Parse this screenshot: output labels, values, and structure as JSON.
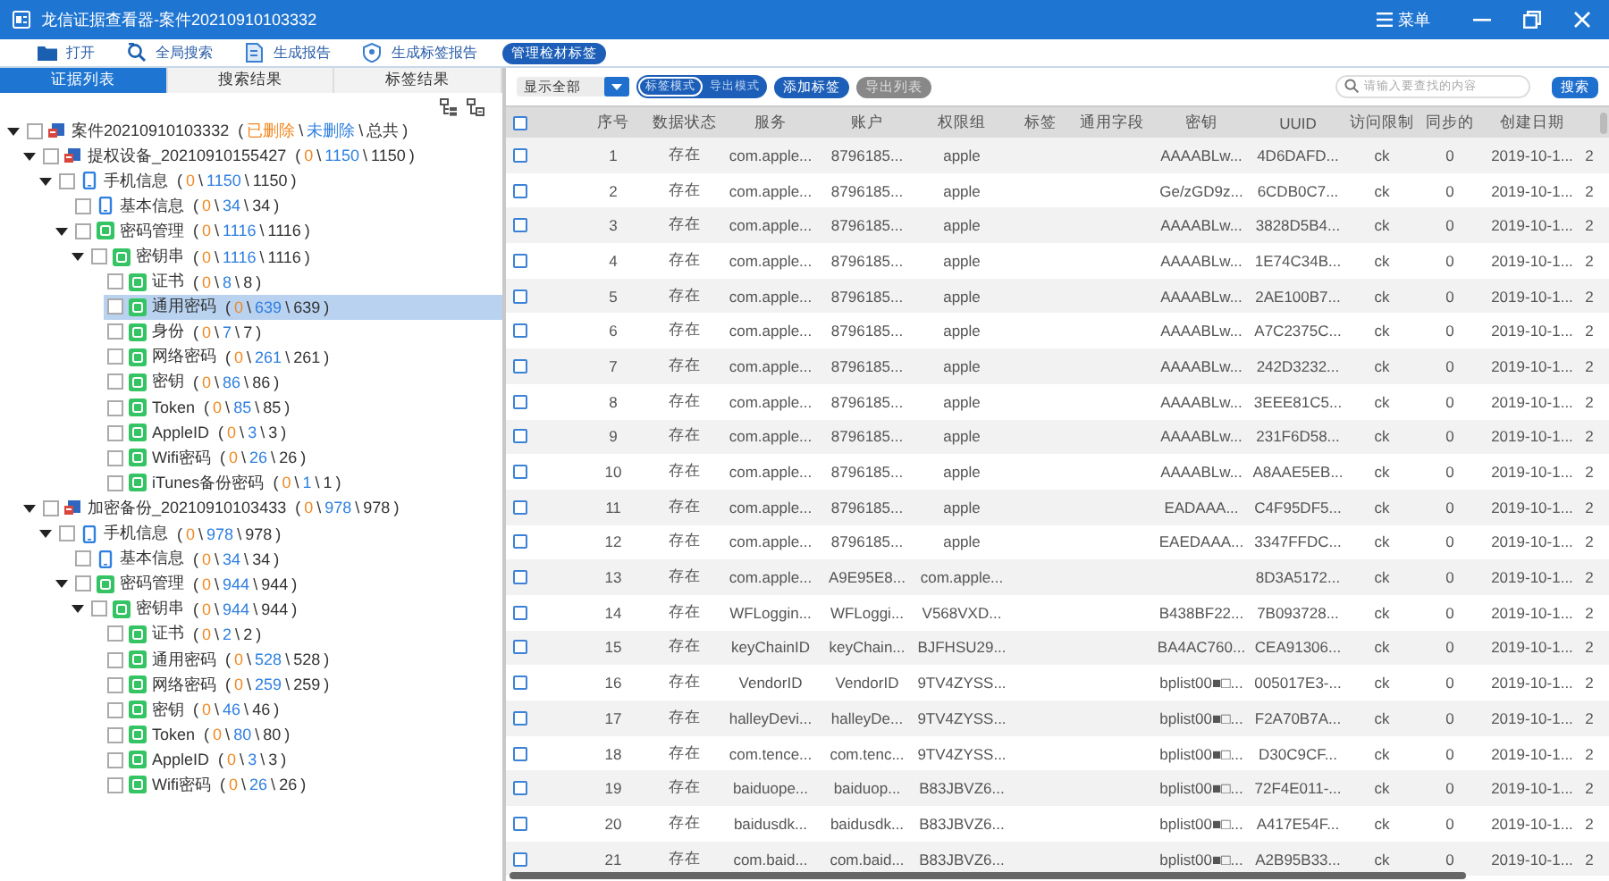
{
  "window": {
    "title": "龙信证据查看器-案件20210910103332",
    "menu": "菜单"
  },
  "toolbar": [
    {
      "label": "打开",
      "kind": "folder"
    },
    {
      "label": "全局搜索",
      "kind": "search"
    },
    {
      "label": "生成报告",
      "kind": "report"
    },
    {
      "label": "生成标签报告",
      "kind": "tag"
    }
  ],
  "manage_button": "管理检材标签",
  "left_tabs": [
    {
      "label": "证据列表",
      "selected": true
    },
    {
      "label": "搜索结果",
      "selected": false
    },
    {
      "label": "标签结果",
      "selected": false
    }
  ],
  "tree": [
    {
      "label": "案件20210910103332",
      "kind": "case",
      "counts": [
        "(",
        "已删除",
        "\\",
        "未删除",
        "\\",
        "总共",
        ")"
      ],
      "checked": false,
      "expanded": true,
      "selected": false,
      "children": [
        {
          "label": "提权设备_20210910155427",
          "kind": "case",
          "counts": [
            "(",
            "0",
            "\\",
            "1150",
            "\\",
            "1150",
            ")"
          ],
          "checked": false,
          "expanded": true,
          "selected": false,
          "children": [
            {
              "label": "手机信息",
              "kind": "phone",
              "counts": [
                "(",
                "0",
                "\\",
                "1150",
                "\\",
                "1150",
                ")"
              ],
              "checked": false,
              "expanded": true,
              "selected": false,
              "children": [
                {
                  "label": "基本信息",
                  "kind": "phone",
                  "counts": [
                    "(",
                    "0",
                    "\\",
                    "34",
                    "\\",
                    "34",
                    ")"
                  ],
                  "checked": false,
                  "selected": false
                },
                {
                  "label": "密码管理",
                  "kind": "category",
                  "counts": [
                    "(",
                    "0",
                    "\\",
                    "1116",
                    "\\",
                    "1116",
                    ")"
                  ],
                  "checked": false,
                  "expanded": true,
                  "selected": false,
                  "children": [
                    {
                      "label": "密钥串",
                      "kind": "category",
                      "counts": [
                        "(",
                        "0",
                        "\\",
                        "1116",
                        "\\",
                        "1116",
                        ")"
                      ],
                      "checked": false,
                      "expanded": true,
                      "selected": false,
                      "children": [
                        {
                          "label": "证书",
                          "kind": "category",
                          "counts": [
                            "(",
                            "0",
                            "\\",
                            "8",
                            "\\",
                            "8",
                            ")"
                          ],
                          "checked": false,
                          "selected": false
                        },
                        {
                          "label": "通用密码",
                          "kind": "category",
                          "counts": [
                            "(",
                            "0",
                            "\\",
                            "639",
                            "\\",
                            "639",
                            ")"
                          ],
                          "checked": false,
                          "selected": true
                        },
                        {
                          "label": "身份",
                          "kind": "category",
                          "counts": [
                            "(",
                            "0",
                            "\\",
                            "7",
                            "\\",
                            "7",
                            ")"
                          ],
                          "checked": false,
                          "selected": false
                        },
                        {
                          "label": "网络密码",
                          "kind": "category",
                          "counts": [
                            "(",
                            "0",
                            "\\",
                            "261",
                            "\\",
                            "261",
                            ")"
                          ],
                          "checked": false,
                          "selected": false
                        },
                        {
                          "label": "密钥",
                          "kind": "category",
                          "counts": [
                            "(",
                            "0",
                            "\\",
                            "86",
                            "\\",
                            "86",
                            ")"
                          ],
                          "checked": false,
                          "selected": false
                        },
                        {
                          "label": "Token",
                          "kind": "category",
                          "counts": [
                            "(",
                            "0",
                            "\\",
                            "85",
                            "\\",
                            "85",
                            ")"
                          ],
                          "checked": false,
                          "selected": false
                        },
                        {
                          "label": "AppleID",
                          "kind": "category",
                          "counts": [
                            "(",
                            "0",
                            "\\",
                            "3",
                            "\\",
                            "3",
                            ")"
                          ],
                          "checked": false,
                          "selected": false
                        },
                        {
                          "label": "Wifi密码",
                          "kind": "category",
                          "counts": [
                            "(",
                            "0",
                            "\\",
                            "26",
                            "\\",
                            "26",
                            ")"
                          ],
                          "checked": false,
                          "selected": false
                        },
                        {
                          "label": "iTunes备份密码",
                          "kind": "category",
                          "counts": [
                            "(",
                            "0",
                            "\\",
                            "1",
                            "\\",
                            "1",
                            ")"
                          ],
                          "checked": false,
                          "selected": false
                        }
                      ]
                    }
                  ]
                }
              ]
            }
          ]
        },
        {
          "label": "加密备份_20210910103433",
          "kind": "case",
          "counts": [
            "(",
            "0",
            "\\",
            "978",
            "\\",
            "978",
            ")"
          ],
          "checked": false,
          "expanded": true,
          "selected": false,
          "children": [
            {
              "label": "手机信息",
              "kind": "phone",
              "counts": [
                "(",
                "0",
                "\\",
                "978",
                "\\",
                "978",
                ")"
              ],
              "checked": false,
              "expanded": true,
              "selected": false,
              "children": [
                {
                  "label": "基本信息",
                  "kind": "phone",
                  "counts": [
                    "(",
                    "0",
                    "\\",
                    "34",
                    "\\",
                    "34",
                    ")"
                  ],
                  "checked": false,
                  "selected": false
                },
                {
                  "label": "密码管理",
                  "kind": "category",
                  "counts": [
                    "(",
                    "0",
                    "\\",
                    "944",
                    "\\",
                    "944",
                    ")"
                  ],
                  "checked": false,
                  "expanded": true,
                  "selected": false,
                  "children": [
                    {
                      "label": "密钥串",
                      "kind": "category",
                      "counts": [
                        "(",
                        "0",
                        "\\",
                        "944",
                        "\\",
                        "944",
                        ")"
                      ],
                      "checked": false,
                      "expanded": true,
                      "selected": false,
                      "children": [
                        {
                          "label": "证书",
                          "kind": "category",
                          "counts": [
                            "(",
                            "0",
                            "\\",
                            "2",
                            "\\",
                            "2",
                            ")"
                          ],
                          "checked": false,
                          "selected": false
                        },
                        {
                          "label": "通用密码",
                          "kind": "category",
                          "counts": [
                            "(",
                            "0",
                            "\\",
                            "528",
                            "\\",
                            "528",
                            ")"
                          ],
                          "checked": false,
                          "selected": false
                        },
                        {
                          "label": "网络密码",
                          "kind": "category",
                          "counts": [
                            "(",
                            "0",
                            "\\",
                            "259",
                            "\\",
                            "259",
                            ")"
                          ],
                          "checked": false,
                          "selected": false
                        },
                        {
                          "label": "密钥",
                          "kind": "category",
                          "counts": [
                            "(",
                            "0",
                            "\\",
                            "46",
                            "\\",
                            "46",
                            ")"
                          ],
                          "checked": false,
                          "selected": false
                        },
                        {
                          "label": "Token",
                          "kind": "category",
                          "counts": [
                            "(",
                            "0",
                            "\\",
                            "80",
                            "\\",
                            "80",
                            ")"
                          ],
                          "checked": false,
                          "selected": false
                        },
                        {
                          "label": "AppleID",
                          "kind": "category",
                          "counts": [
                            "(",
                            "0",
                            "\\",
                            "3",
                            "\\",
                            "3",
                            ")"
                          ],
                          "checked": false,
                          "selected": false
                        },
                        {
                          "label": "Wifi密码",
                          "kind": "category",
                          "counts": [
                            "(",
                            "0",
                            "\\",
                            "26",
                            "\\",
                            "26",
                            ")"
                          ],
                          "checked": false,
                          "selected": false
                        }
                      ]
                    }
                  ]
                }
              ]
            }
          ]
        }
      ]
    }
  ],
  "filter": {
    "value": "显示全部"
  },
  "mode_toggle": [
    {
      "label": "标签模式",
      "selected": true
    },
    {
      "label": "导出模式",
      "selected": false
    }
  ],
  "actions": [
    {
      "label": "添加标签",
      "disabled": false
    },
    {
      "label": "导出列表",
      "disabled": true
    }
  ],
  "search": {
    "placeholder": "请输入要查找的内容",
    "button": "搜索"
  },
  "table": {
    "header_checked": false,
    "columns": [
      "序号",
      "数据状态",
      "服务",
      "账户",
      "权限组",
      "标签",
      "通用字段",
      "密钥",
      "UUID",
      "访问限制",
      "同步的",
      "创建日期"
    ],
    "rows": [
      {
        "checked": false,
        "cells": [
          "1",
          "存在",
          "com.apple...",
          "8796185...",
          "apple",
          null,
          null,
          "AAAABLw...",
          "4D6DAFD...",
          "ck",
          "0",
          "2019-10-1...",
          "2"
        ]
      },
      {
        "checked": false,
        "cells": [
          "2",
          "存在",
          "com.apple...",
          "8796185...",
          "apple",
          null,
          null,
          "Ge/zGD9z...",
          "6CDB0C7...",
          "ck",
          "0",
          "2019-10-1...",
          "2"
        ]
      },
      {
        "checked": false,
        "cells": [
          "3",
          "存在",
          "com.apple...",
          "8796185...",
          "apple",
          null,
          null,
          "AAAABLw...",
          "3828D5B4...",
          "ck",
          "0",
          "2019-10-1...",
          "2"
        ]
      },
      {
        "checked": false,
        "cells": [
          "4",
          "存在",
          "com.apple...",
          "8796185...",
          "apple",
          null,
          null,
          "AAAABLw...",
          "1E74C34B...",
          "ck",
          "0",
          "2019-10-1...",
          "2"
        ]
      },
      {
        "checked": false,
        "cells": [
          "5",
          "存在",
          "com.apple...",
          "8796185...",
          "apple",
          null,
          null,
          "AAAABLw...",
          "2AE100B7...",
          "ck",
          "0",
          "2019-10-1...",
          "2"
        ]
      },
      {
        "checked": false,
        "cells": [
          "6",
          "存在",
          "com.apple...",
          "8796185...",
          "apple",
          null,
          null,
          "AAAABLw...",
          "A7C2375C...",
          "ck",
          "0",
          "2019-10-1...",
          "2"
        ]
      },
      {
        "checked": false,
        "cells": [
          "7",
          "存在",
          "com.apple...",
          "8796185...",
          "apple",
          null,
          null,
          "AAAABLw...",
          "242D3232...",
          "ck",
          "0",
          "2019-10-1...",
          "2"
        ]
      },
      {
        "checked": false,
        "cells": [
          "8",
          "存在",
          "com.apple...",
          "8796185...",
          "apple",
          null,
          null,
          "AAAABLw...",
          "3EEE81C5...",
          "ck",
          "0",
          "2019-10-1...",
          "2"
        ]
      },
      {
        "checked": false,
        "cells": [
          "9",
          "存在",
          "com.apple...",
          "8796185...",
          "apple",
          null,
          null,
          "AAAABLw...",
          "231F6D58...",
          "ck",
          "0",
          "2019-10-1...",
          "2"
        ]
      },
      {
        "checked": false,
        "cells": [
          "10",
          "存在",
          "com.apple...",
          "8796185...",
          "apple",
          null,
          null,
          "AAAABLw...",
          "A8AAE5EB...",
          "ck",
          "0",
          "2019-10-1...",
          "2"
        ]
      },
      {
        "checked": false,
        "cells": [
          "11",
          "存在",
          "com.apple...",
          "8796185...",
          "apple",
          null,
          null,
          "EADAAA...",
          "C4F95DF5...",
          "ck",
          "0",
          "2019-10-1...",
          "2"
        ]
      },
      {
        "checked": false,
        "cells": [
          "12",
          "存在",
          "com.apple...",
          "8796185...",
          "apple",
          null,
          null,
          "EAEDAAA...",
          "3347FFDC...",
          "ck",
          "0",
          "2019-10-1...",
          "2"
        ]
      },
      {
        "checked": false,
        "cells": [
          "13",
          "存在",
          "com.apple...",
          "A9E95E8...",
          "com.apple...",
          null,
          null,
          null,
          "8D3A5172...",
          "ck",
          "0",
          "2019-10-1...",
          "2"
        ]
      },
      {
        "checked": false,
        "cells": [
          "14",
          "存在",
          "WFLoggin...",
          "WFLoggi...",
          "V568VXD...",
          null,
          null,
          "B438BF22...",
          "7B093728...",
          "ck",
          "0",
          "2019-10-1...",
          "2"
        ]
      },
      {
        "checked": false,
        "cells": [
          "15",
          "存在",
          "keyChainID",
          "keyChain...",
          "BJFHSU29...",
          null,
          null,
          "BA4AC760...",
          "CEA91306...",
          "ck",
          "0",
          "2019-10-1...",
          "2"
        ]
      },
      {
        "checked": false,
        "cells": [
          "16",
          "存在",
          "VendorID",
          "VendorID",
          "9TV4ZYSS...",
          null,
          null,
          "bplist00■□...",
          "005017E3-...",
          "ck",
          "0",
          "2019-10-1...",
          "2"
        ]
      },
      {
        "checked": false,
        "cells": [
          "17",
          "存在",
          "halleyDevi...",
          "halleyDe...",
          "9TV4ZYSS...",
          null,
          null,
          "bplist00■□...",
          "F2A70B7A...",
          "ck",
          "0",
          "2019-10-1...",
          "2"
        ]
      },
      {
        "checked": false,
        "cells": [
          "18",
          "存在",
          "com.tence...",
          "com.tenc...",
          "9TV4ZYSS...",
          null,
          null,
          "bplist00■□...",
          "D30C9CF...",
          "ck",
          "0",
          "2019-10-1...",
          "2"
        ]
      },
      {
        "checked": false,
        "cells": [
          "19",
          "存在",
          "baiduope...",
          "baiduop...",
          "B83JBVZ6...",
          null,
          null,
          "bplist00■□...",
          "72F4E011-...",
          "ck",
          "0",
          "2019-10-1...",
          "2"
        ]
      },
      {
        "checked": false,
        "cells": [
          "20",
          "存在",
          "baidusdk...",
          "baidusdk...",
          "B83JBVZ6...",
          null,
          null,
          "bplist00■□...",
          "A417E54F...",
          "ck",
          "0",
          "2019-10-1...",
          "2"
        ]
      },
      {
        "checked": false,
        "cells": [
          "21",
          "存在",
          "com.baid...",
          "com.baid...",
          "B83JBVZ6...",
          null,
          null,
          "bplist00■□...",
          "A2B95B33...",
          "ck",
          "0",
          "2019-10-1...",
          "2"
        ]
      }
    ]
  }
}
